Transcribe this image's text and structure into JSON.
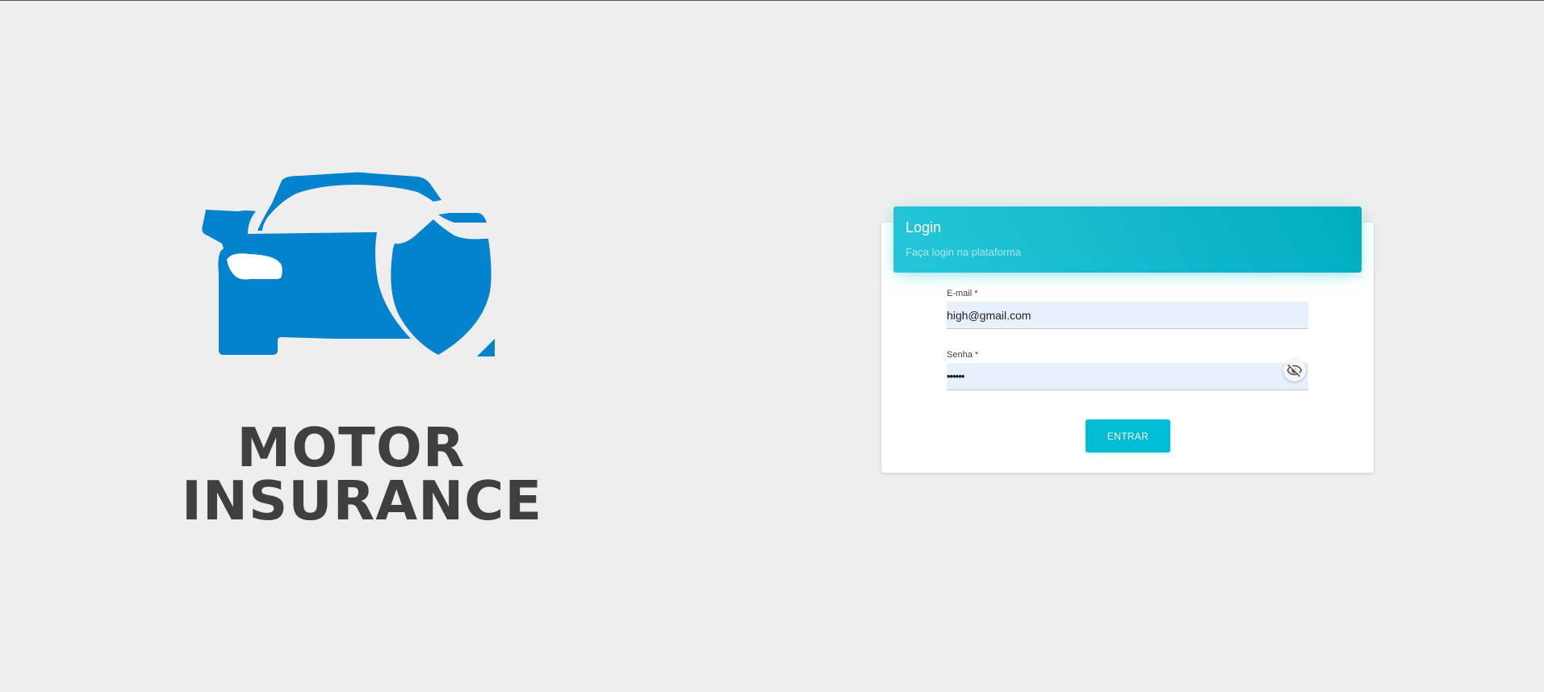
{
  "brand": {
    "logo_icon": "car-shield-icon",
    "line1": "MOTOR",
    "line2": "INSURANCE",
    "logo_color": "#0382ce",
    "text_color": "#3f3f3f"
  },
  "login": {
    "title": "Login",
    "subtitle": "Faça login na plataforma",
    "header_color": "#1ebfd5",
    "email": {
      "label": "E-mail *",
      "value": "high@gmail.com"
    },
    "password": {
      "label": "Senha *",
      "value": "••••••",
      "toggle_icon": "eye-off-icon"
    },
    "submit_label": "ENTRAR",
    "submit_color": "#00bcd4"
  }
}
